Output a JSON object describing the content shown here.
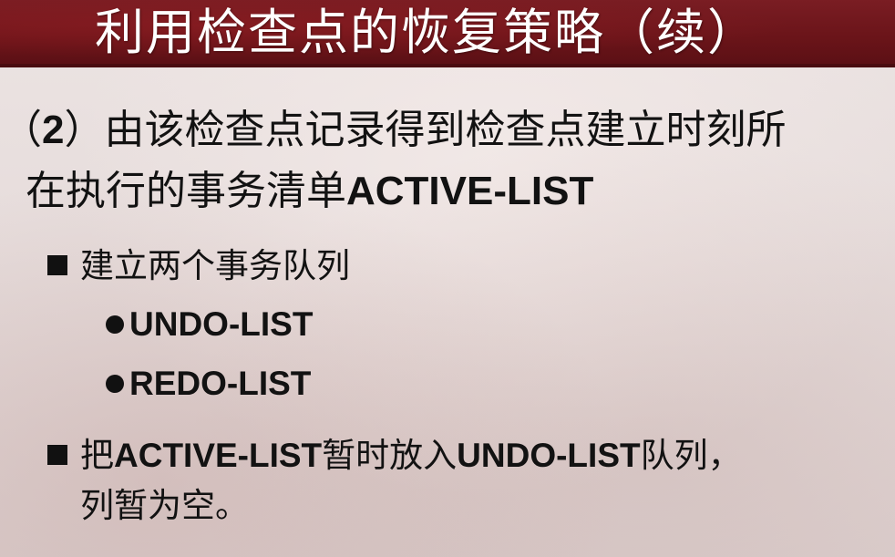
{
  "slide": {
    "title": "利用检查点的恢复策略（续）",
    "line1_prefix": "（",
    "line1_num": "2",
    "line1_text": "）由该检查点记录得到检查点建立时刻所",
    "line2_text": "在执行的事务清单",
    "line2_term": "ACTIVE-LIST",
    "bullet1_text": "建立两个事务队列",
    "sub1_text": "UNDO-LIST",
    "sub2_text": "REDO-LIST",
    "bullet2_part1": "把",
    "bullet2_term1": "ACTIVE-LIST",
    "bullet2_part2": "暂时放入",
    "bullet2_term2": "UNDO-LIST",
    "bullet2_part3": "队列，",
    "bullet2_cont": "列暂为空。"
  }
}
